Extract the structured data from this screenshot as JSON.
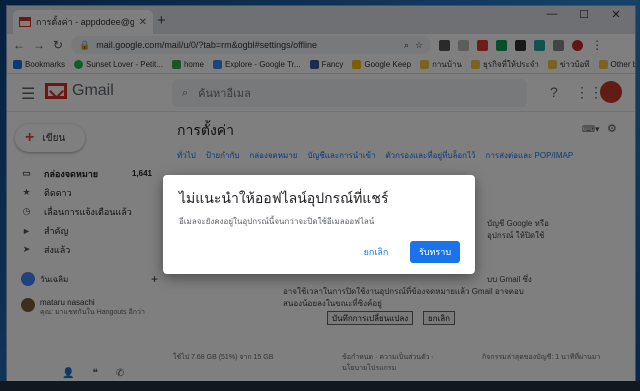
{
  "browser": {
    "tab_title": "การตั้งค่า - appdodee@gmail.com",
    "url": "mail.google.com/mail/u/0/?tab=rm&ogbl#settings/offline"
  },
  "bookmarks": [
    "Bookmarks",
    "Sunset Lover - Petit...",
    "home",
    "Explore - Google Tr...",
    "Fancy",
    "Google Keep",
    "กานบ้าน",
    "ธุรกิจที่ให้ประจำ",
    "ข่าวบ้อที",
    "Other bookmarks"
  ],
  "gmail": {
    "brand": "Gmail",
    "search_placeholder": "ค้นหาอีเมล",
    "compose": "เขียน",
    "nav": [
      {
        "label": "กล่องจดหมาย",
        "count": "1,641"
      },
      {
        "label": "ติดดาว",
        "count": ""
      },
      {
        "label": "เลื่อนการแจ้งเตือนแล้ว",
        "count": ""
      },
      {
        "label": "สำคัญ",
        "count": ""
      },
      {
        "label": "ส่งแล้ว",
        "count": ""
      }
    ],
    "user_section": "วันเฉลิม",
    "contact_name": "mataru nasachi",
    "contact_sub": "คุณ: มาแชทกันใน Hangouts อีกว่า"
  },
  "settings": {
    "title": "การตั้งค่า",
    "tabs": [
      "ทั่วไป",
      "ป้ายกำกับ",
      "กล่องจดหมาย",
      "บัญชีและการนำเข้า",
      "ตัวกรองและที่อยู่ที่บล็อกไว้",
      "การส่งต่อและ POP/IMAP"
    ],
    "text1": "บัญชี Google หรือ",
    "text2": "อุปกรณ์ ให้ปิดใช้",
    "text3": "บบ Gmail ซึ่ง",
    "text4": "อาจใช้เวลาในการปิดใช้งานอุปกรณ์ที่ข้องจดหมายแล้ว Gmail อาจตอบ",
    "text5": "สนองน้อยลงในขณะที่ซิงค์อยู่",
    "save": "บันทึกการเปลี่ยนแปลง",
    "cancel": "ยกเลิก",
    "footer_storage": "ใช้ไป 7.68 GB (51%) จาก 15 GB",
    "footer_terms": "ข้อกำหนด · ความเป็นส่วนตัว · นโยบายโปรแกรม",
    "footer_activity": "กิจกรรมล่าสุดของบัญชี: 1 นาทีที่ผ่านมา"
  },
  "dialog": {
    "title": "ไม่แนะนำให้ออฟไลน์อุปกรณ์ที่แชร์",
    "message": "อีเมลจะยังคงอยู่ในอุปกรณ์นี้จนกว่าจะปิดใช้อีเมลออฟไลน์",
    "cancel": "ยกเลิก",
    "ok": "รับทราบ"
  }
}
